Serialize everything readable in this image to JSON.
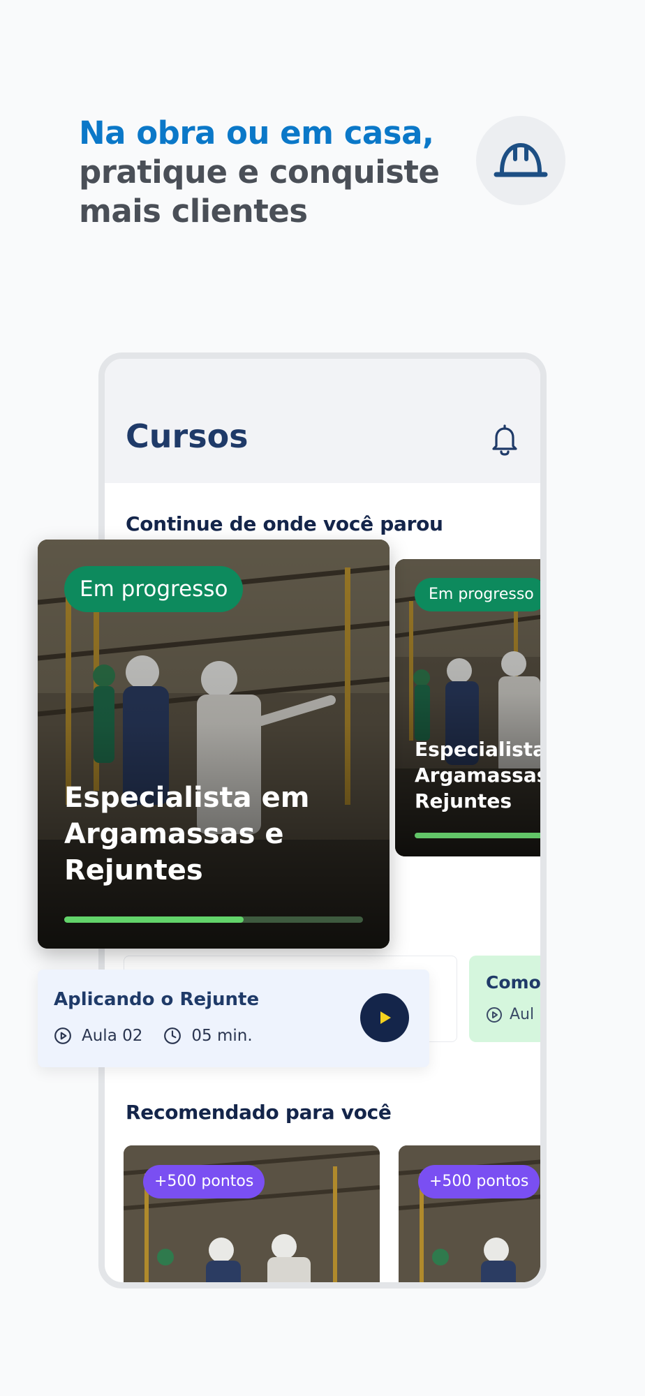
{
  "headline": {
    "line1": "Na obra ou em casa,",
    "line2": "pratique e conquiste",
    "line3": "mais clientes"
  },
  "icons": {
    "helmet": "helmet-icon",
    "bell": "bell-icon",
    "play": "play-icon",
    "lesson": "play-circle-icon",
    "clock": "clock-icon"
  },
  "app": {
    "title": "Cursos",
    "continue_section_title": "Continue de onde você parou",
    "recommended_section_title": "Recomendado para você"
  },
  "featured_course": {
    "badge": "Em progresso",
    "title": "Especialista em Argamassas e Rejuntes",
    "progress": 0.6
  },
  "second_course": {
    "badge": "Em progresso",
    "title": "Especialista em Argamassas e Rejuntes"
  },
  "current_lesson": {
    "title": "Aplicando o Rejunte",
    "lesson_number": "Aula 02",
    "duration": "05 min."
  },
  "next_lesson": {
    "title": "Como",
    "lesson_number": "Aul"
  },
  "recommended": [
    {
      "badge": "+500 pontos"
    },
    {
      "badge": "+500 pontos"
    }
  ],
  "colors": {
    "brand_blue": "#0b78c8",
    "navy": "#14254a",
    "progress_green": "#0d8a5d",
    "points_purple": "#7a4ff2",
    "play_yellow": "#f4d21f"
  }
}
